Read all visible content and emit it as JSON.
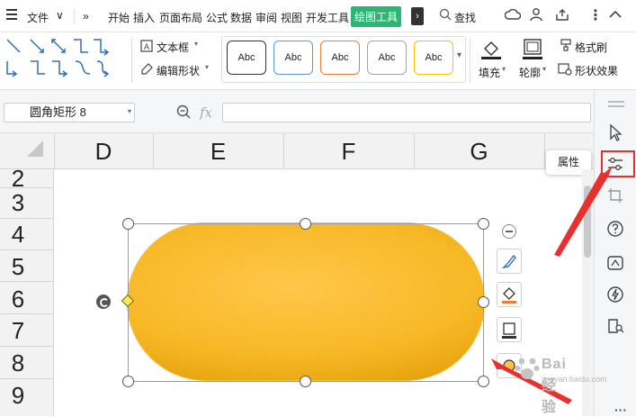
{
  "menu": {
    "file": "文件",
    "tabs": [
      "开始",
      "插入",
      "页面布局",
      "公式",
      "数据",
      "审阅",
      "视图",
      "开发工具"
    ],
    "active_tab": "绘图工具",
    "search": "查找"
  },
  "ribbon": {
    "text_box": "文本框",
    "edit_shape": "编辑形状",
    "style_preset_label": "Abc",
    "style_preset_colors": [
      "#333333",
      "#5b9bd5",
      "#ed7d31",
      "#a5a5a5",
      "#ffc000"
    ],
    "fill": "填充",
    "outline": "轮廓",
    "format_painter": "格式刷",
    "shape_effects": "形状效果"
  },
  "formula_bar": {
    "name_box": "圆角矩形 8",
    "fx": "fx",
    "formula": ""
  },
  "sheet": {
    "columns": [
      "D",
      "E",
      "F",
      "G"
    ],
    "rows": [
      "2",
      "3",
      "4",
      "5",
      "6",
      "7",
      "8",
      "9"
    ]
  },
  "shape": {
    "type": "rounded-rectangle",
    "fill_start": "#ffc64a",
    "fill_end": "#e9a50f"
  },
  "side_panel": {
    "tooltip": "属性",
    "highlight_color": "#e8312f"
  },
  "watermark": {
    "brand": "Bai 经验",
    "url": "jingyan.baidu.com"
  }
}
